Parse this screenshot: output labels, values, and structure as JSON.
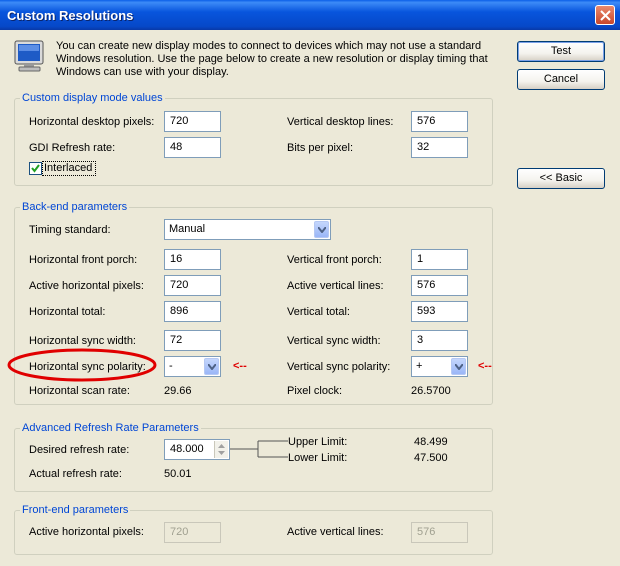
{
  "window": {
    "title": "Custom Resolutions",
    "intro": "You can create new display modes to connect to devices which may not use a standard Windows resolution. Use the page below to create a new resolution or display timing that Windows can use with your display."
  },
  "buttons": {
    "test": "Test",
    "cancel": "Cancel",
    "basic": "<< Basic"
  },
  "custom_mode": {
    "legend": "Custom display mode values",
    "h_desktop_label": "Horizontal desktop pixels:",
    "h_desktop_value": "720",
    "v_desktop_label": "Vertical desktop lines:",
    "v_desktop_value": "576",
    "gdi_label": "GDI Refresh rate:",
    "gdi_value": "48",
    "bpp_label": "Bits per pixel:",
    "bpp_value": "32",
    "interlaced_label": "Interlaced",
    "interlaced_checked": true
  },
  "backend": {
    "legend": "Back-end parameters",
    "timing_label": "Timing standard:",
    "timing_value": "Manual",
    "h_front_label": "Horizontal front porch:",
    "h_front_value": "16",
    "v_front_label": "Vertical front porch:",
    "v_front_value": "1",
    "active_h_label": "Active horizontal pixels:",
    "active_h_value": "720",
    "active_v_label": "Active vertical lines:",
    "active_v_value": "576",
    "h_total_label": "Horizontal total:",
    "h_total_value": "896",
    "v_total_label": "Vertical total:",
    "v_total_value": "593",
    "h_sync_w_label": "Horizontal sync width:",
    "h_sync_w_value": "72",
    "v_sync_w_label": "Vertical sync width:",
    "v_sync_w_value": "3",
    "h_sync_pol_label": "Horizontal sync polarity:",
    "h_sync_pol_value": "-",
    "v_sync_pol_label": "Vertical sync polarity:",
    "v_sync_pol_value": "+",
    "arrow_mark": "<--",
    "h_scan_label": "Horizontal scan rate:",
    "h_scan_value": "29.66",
    "pixel_clock_label": "Pixel clock:",
    "pixel_clock_value": "26.5700"
  },
  "advanced": {
    "legend": "Advanced Refresh Rate Parameters",
    "desired_label": "Desired refresh rate:",
    "desired_value": "48.000",
    "upper_label": "Upper Limit:",
    "upper_value": "48.499",
    "lower_label": "Lower Limit:",
    "lower_value": "47.500",
    "actual_label": "Actual refresh rate:",
    "actual_value": "50.01"
  },
  "frontend": {
    "legend": "Front-end parameters",
    "active_h_label": "Active horizontal pixels:",
    "active_h_value": "720",
    "active_v_label": "Active vertical lines:",
    "active_v_value": "576"
  },
  "colors": {
    "accent": "#0046D5",
    "highlight_circle": "#E00000",
    "titlebar": "#0855DD"
  }
}
